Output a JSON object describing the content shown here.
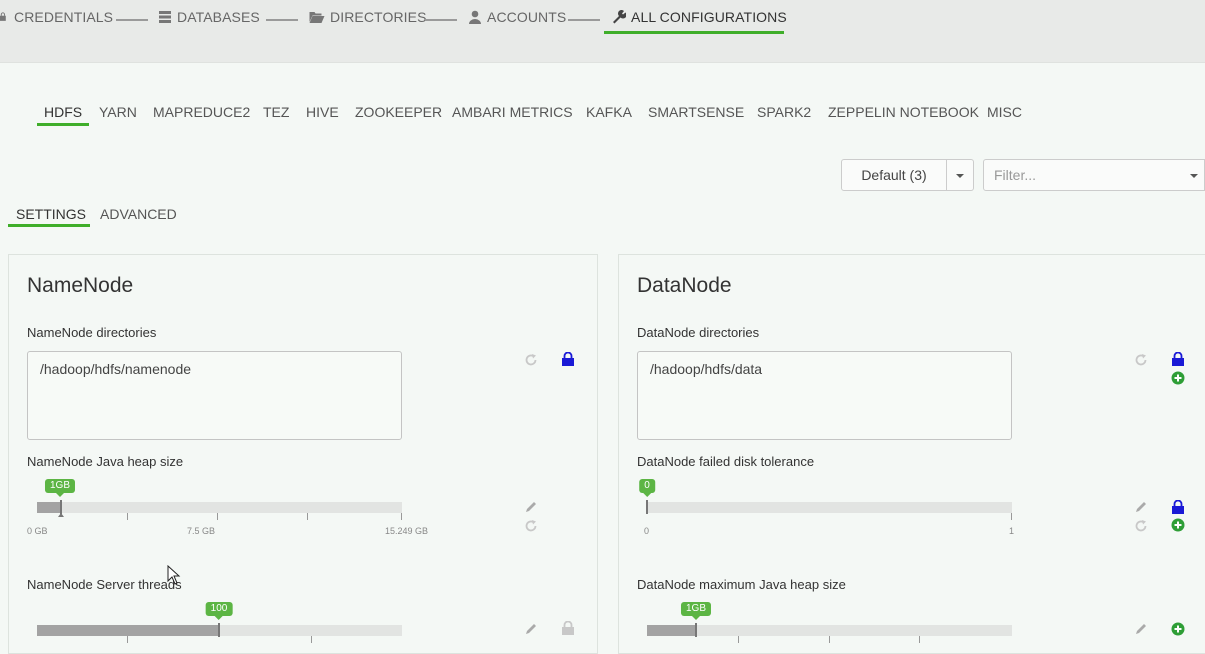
{
  "wizard": {
    "steps": [
      {
        "label": "CREDENTIALS",
        "icon": "lock-icon"
      },
      {
        "label": "DATABASES",
        "icon": "database-icon"
      },
      {
        "label": "DIRECTORIES",
        "icon": "folder-open-icon"
      },
      {
        "label": "ACCOUNTS",
        "icon": "user-icon"
      },
      {
        "label": "ALL CONFIGURATIONS",
        "icon": "wrench-icon",
        "active": true
      }
    ]
  },
  "service_tabs": [
    "HDFS",
    "YARN",
    "MAPREDUCE2",
    "TEZ",
    "HIVE",
    "ZOOKEEPER",
    "AMBARI METRICS",
    "KAFKA",
    "SMARTSENSE",
    "SPARK2",
    "ZEPPELIN NOTEBOOK",
    "MISC"
  ],
  "active_service": "HDFS",
  "config_group": {
    "label": "Default (3)"
  },
  "filter": {
    "placeholder": "Filter..."
  },
  "sub_tabs": [
    "SETTINGS",
    "ADVANCED"
  ],
  "active_sub_tab": "SETTINGS",
  "colors": {
    "accent": "#3fae2a",
    "bubble": "#5cb544",
    "lock": "#1a1ad6",
    "add": "#2e9e36"
  },
  "namenode": {
    "title": "NameNode",
    "dirs": {
      "label": "NameNode directories",
      "value": "/hadoop/hdfs/namenode"
    },
    "heap": {
      "label": "NameNode Java heap size",
      "value_label": "1GB",
      "value": 1,
      "min": 0,
      "max": 15.249,
      "ticks": [
        "0 GB",
        "7.5 GB",
        "15.249 GB"
      ]
    },
    "threads": {
      "label": "NameNode Server threads",
      "value_label": "100"
    }
  },
  "datanode": {
    "title": "DataNode",
    "dirs": {
      "label": "DataNode directories",
      "value": "/hadoop/hdfs/data"
    },
    "disk_tolerance": {
      "label": "DataNode failed disk tolerance",
      "value_label": "0",
      "value": 0,
      "min": 0,
      "max": 1,
      "ticks": [
        "0",
        "1"
      ]
    },
    "heap": {
      "label": "DataNode maximum Java heap size",
      "value_label": "1GB"
    }
  }
}
